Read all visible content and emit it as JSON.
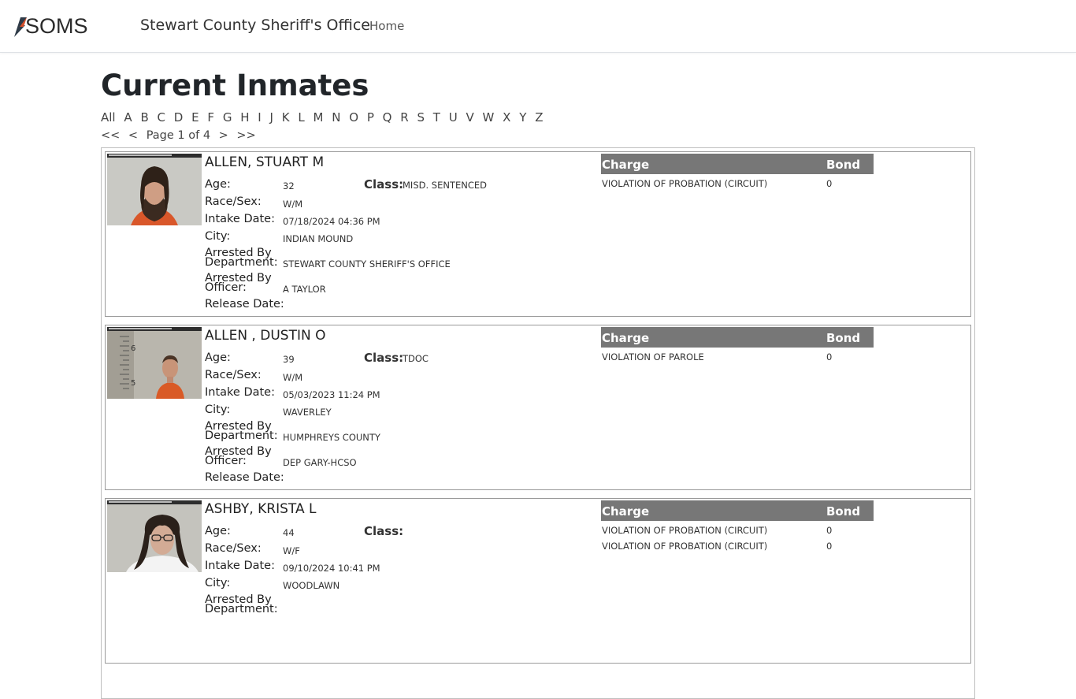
{
  "nav": {
    "brand": "SOMS",
    "site_title": "Stewart County Sheriff's Office",
    "home": "Home"
  },
  "page": {
    "title": "Current Inmates",
    "alphabet": [
      "All",
      "A",
      "B",
      "C",
      "D",
      "E",
      "F",
      "G",
      "H",
      "I",
      "J",
      "K",
      "L",
      "M",
      "N",
      "O",
      "P",
      "Q",
      "R",
      "S",
      "T",
      "U",
      "V",
      "W",
      "X",
      "Y",
      "Z"
    ],
    "pager": {
      "first": "<<",
      "prev": "<",
      "label": "Page 1 of 4",
      "next": ">",
      "last": ">>"
    }
  },
  "labels": {
    "age": "Age:",
    "race_sex": "Race/Sex:",
    "intake": "Intake Date:",
    "city": "City:",
    "dept_1": "Arrested By",
    "dept_2": "Department:",
    "officer_1": "Arrested By",
    "officer_2": "Officer:",
    "release": "Release Date:",
    "class": "Class:",
    "charge": "Charge",
    "bond": "Bond"
  },
  "inmates": [
    {
      "name": "ALLEN, STUART M",
      "age": "32",
      "race_sex": "W/M",
      "intake": "07/18/2024 04:36 PM",
      "city": "INDIAN MOUND",
      "department": "STEWART COUNTY SHERIFF'S OFFICE",
      "officer": "A TAYLOR",
      "release": "",
      "class": "MISD. SENTENCED",
      "charges": [
        {
          "charge": "VIOLATION OF PROBATION (CIRCUIT)",
          "bond": "0"
        }
      ]
    },
    {
      "name": "ALLEN , DUSTIN O",
      "age": "39",
      "race_sex": "W/M",
      "intake": "05/03/2023 11:24 PM",
      "city": "WAVERLEY",
      "department": "HUMPHREYS COUNTY",
      "officer": "DEP GARY-HCSO",
      "release": "",
      "class": "TDOC",
      "charges": [
        {
          "charge": "VIOLATION OF PAROLE",
          "bond": "0"
        }
      ]
    },
    {
      "name": "ASHBY, KRISTA L",
      "age": "44",
      "race_sex": "W/F",
      "intake": "09/10/2024 10:41 PM",
      "city": "WOODLAWN",
      "department": "",
      "officer": "",
      "release": "",
      "class": "",
      "charges": [
        {
          "charge": "VIOLATION OF PROBATION (CIRCUIT)",
          "bond": "0"
        },
        {
          "charge": "VIOLATION OF PROBATION (CIRCUIT)",
          "bond": "0"
        }
      ]
    }
  ]
}
